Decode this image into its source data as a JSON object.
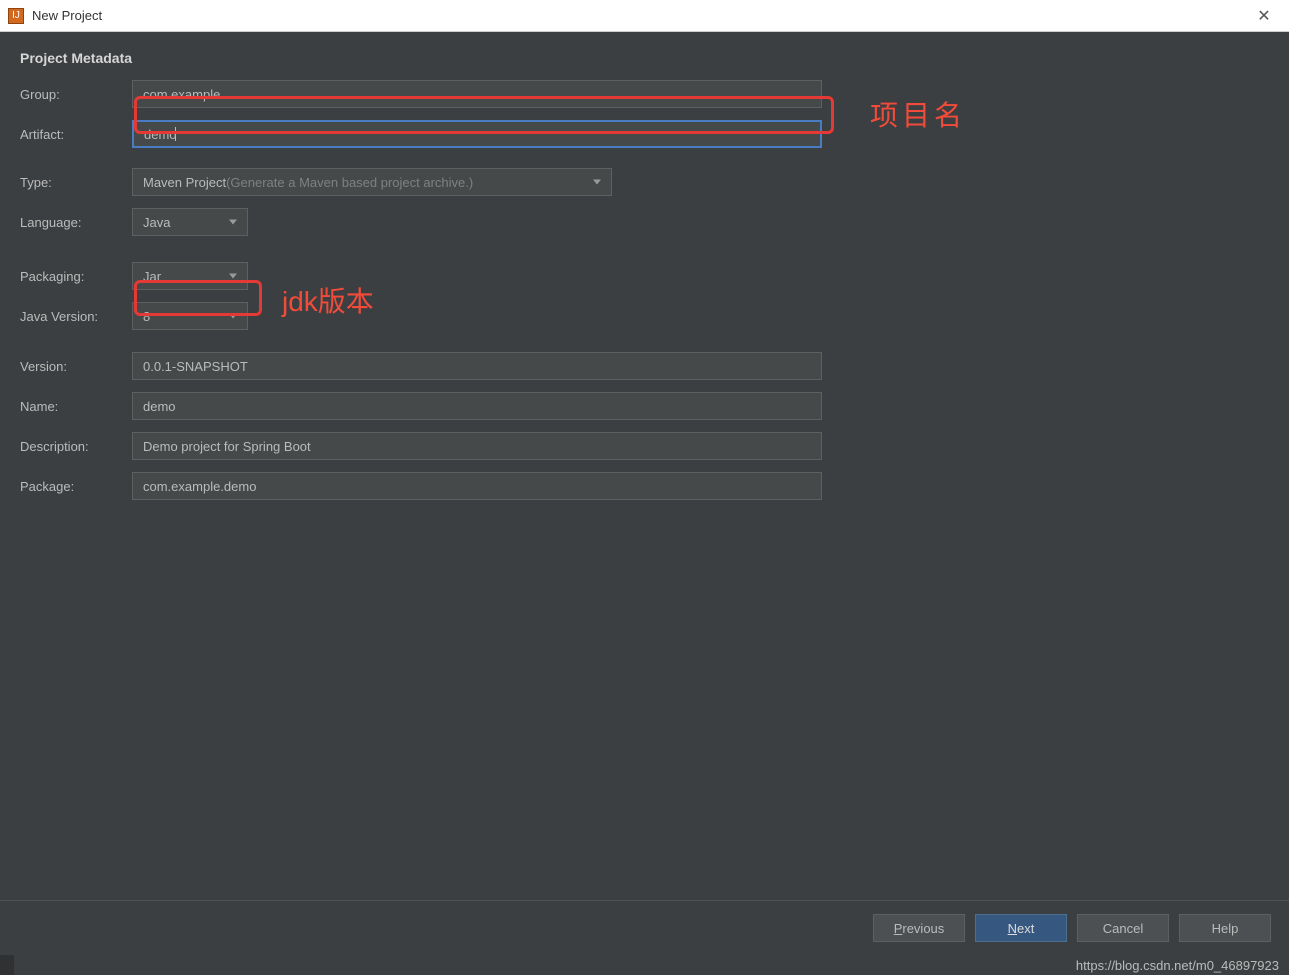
{
  "window": {
    "title": "New Project"
  },
  "section_title": "Project Metadata",
  "labels": {
    "group": "Group:",
    "artifact": "Artifact:",
    "type": "Type:",
    "language": "Language:",
    "packaging": "Packaging:",
    "java_version": "Java Version:",
    "version": "Version:",
    "name": "Name:",
    "description": "Description:",
    "package": "Package:"
  },
  "values": {
    "group": "com.example",
    "artifact": "demo",
    "type_main": "Maven Project",
    "type_hint": " (Generate a Maven based project archive.)",
    "language": "Java",
    "packaging": "Jar",
    "java_version": "8",
    "version": "0.0.1-SNAPSHOT",
    "name": "demo",
    "description": "Demo project for Spring Boot",
    "package": "com.example.demo"
  },
  "annotations": {
    "project_name": "项目名",
    "jdk_version": "jdk版本"
  },
  "buttons": {
    "previous": "Previous",
    "next": "Next",
    "cancel": "Cancel",
    "help": "Help"
  },
  "watermark": "https://blog.csdn.net/m0_46897923"
}
